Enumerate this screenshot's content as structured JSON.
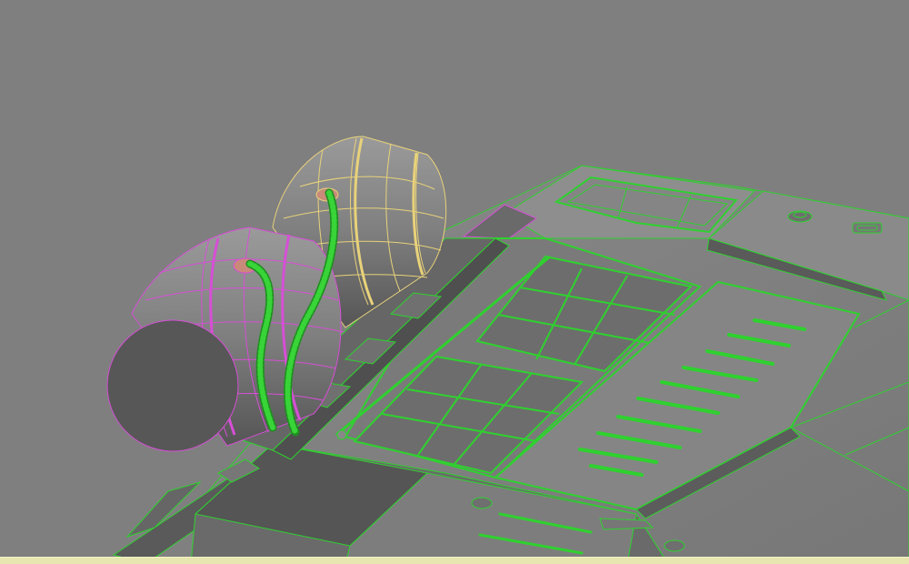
{
  "viewport": {
    "background": "#7f7f7f",
    "border_color": "#e8e6b0"
  },
  "colors": {
    "wire_green": "#2fd12f",
    "wire_magenta": "#d64fd6",
    "wire_yellow": "#e8d27a",
    "surface_dark": "#575757",
    "surface_mid": "#6a6a6a",
    "surface_light": "#8a8a8a"
  }
}
